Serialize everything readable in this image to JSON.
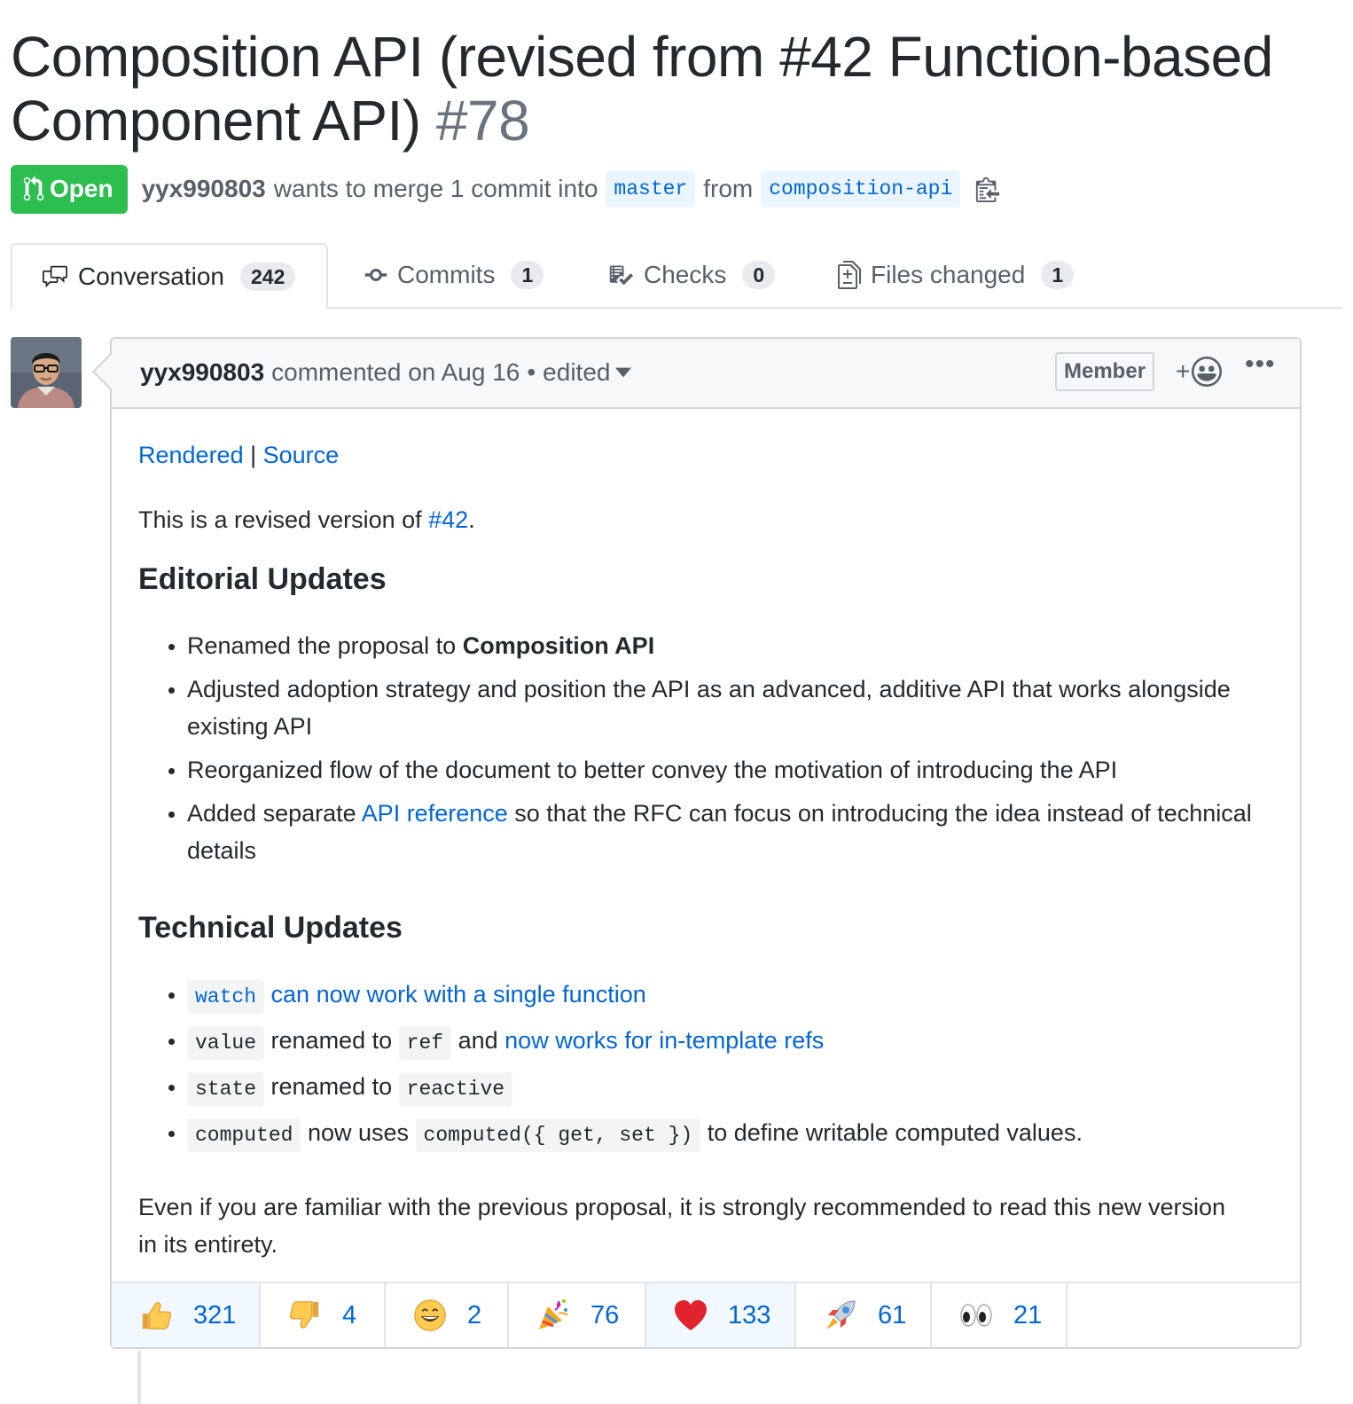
{
  "pr": {
    "title": "Composition API (revised from #42 Function-based Component API)",
    "number": "#78",
    "state": "Open",
    "author": "yyx990803",
    "merge_text": "wants to merge 1 commit into",
    "base_branch": "master",
    "from_text": "from",
    "head_branch": "composition-api"
  },
  "tabs": [
    {
      "label": "Conversation",
      "count": "242",
      "icon": "comment-discussion-icon",
      "selected": true
    },
    {
      "label": "Commits",
      "count": "1",
      "icon": "git-commit-icon"
    },
    {
      "label": "Checks",
      "count": "0",
      "icon": "checklist-icon"
    },
    {
      "label": "Files changed",
      "count": "1",
      "icon": "file-diff-icon"
    }
  ],
  "comment": {
    "author": "yyx990803",
    "action": "commented on Aug 16",
    "separator": "•",
    "edited": "edited",
    "role": "Member",
    "add_reaction": "+",
    "links": {
      "rendered": "Rendered",
      "divider": "|",
      "source": "Source"
    },
    "intro_prefix": "This is a revised version of ",
    "intro_link": "#42",
    "intro_suffix": ".",
    "editorial_heading": "Editorial Updates",
    "editorial": {
      "item1_prefix": "Renamed the proposal to ",
      "item1_bold": "Composition API",
      "item2": "Adjusted adoption strategy and position the API as an advanced, additive API that works alongside existing API",
      "item3": "Reorganized flow of the document to better convey the motivation of introducing the API",
      "item4_prefix": "Added separate ",
      "item4_link": "API reference",
      "item4_suffix": " so that the RFC can focus on introducing the idea instead of technical details"
    },
    "technical_heading": "Technical Updates",
    "technical": {
      "t1_code": "watch",
      "t1_link": "can now work with a single function",
      "t2_code1": "value",
      "t2_text1": "renamed to",
      "t2_code2": "ref",
      "t2_text2": "and",
      "t2_link": "now works for in-template refs",
      "t3_code1": "state",
      "t3_text": "renamed to",
      "t3_code2": "reactive",
      "t4_code1": "computed",
      "t4_text1": "now uses",
      "t4_code2": "computed({ get, set })",
      "t4_text2": "to define writable computed values."
    },
    "closing": "Even if you are familiar with the previous proposal, it is strongly recommended to read this new version in its entirety."
  },
  "reactions": [
    {
      "emoji": "thumbs-up",
      "count": "321",
      "active": true
    },
    {
      "emoji": "thumbs-down",
      "count": "4"
    },
    {
      "emoji": "laugh",
      "count": "2"
    },
    {
      "emoji": "hooray",
      "count": "76"
    },
    {
      "emoji": "heart",
      "count": "133",
      "active": true
    },
    {
      "emoji": "rocket",
      "count": "61"
    },
    {
      "emoji": "eyes",
      "count": "21"
    }
  ],
  "colors": {
    "open_green": "#2cbe4e",
    "link_blue": "#0366d6",
    "branch_bg": "#eaf5ff",
    "header_bg": "#f6f8fa",
    "active_reaction_bg": "#f1f8ff"
  }
}
